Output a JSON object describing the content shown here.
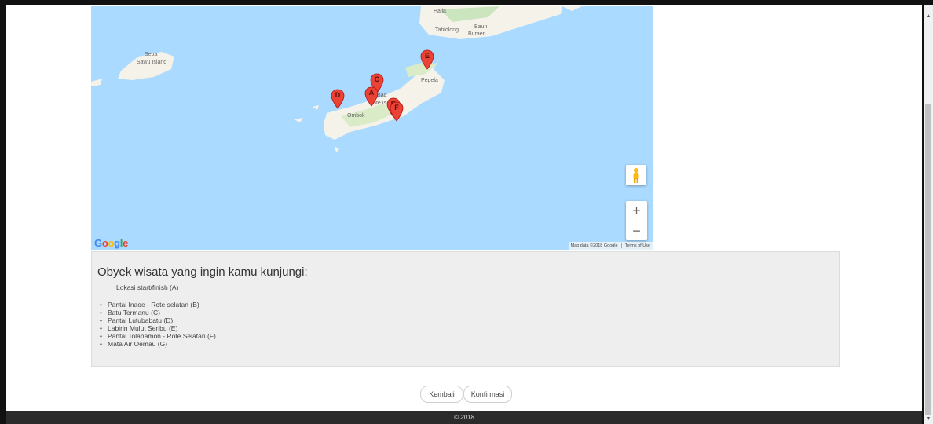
{
  "map": {
    "labels": {
      "halla": "Halla",
      "tablolong": "Tablolong",
      "baun": "Baun",
      "buraen": "Buraen",
      "seba": "Seba",
      "sawu_island": "Sawu Island",
      "pepela": "Pepela",
      "baa": "Baa",
      "rote_island": "Rote Is",
      "ombok": "Ombok"
    },
    "markers": [
      "A",
      "B",
      "C",
      "D",
      "E",
      "F"
    ],
    "logo": "Google",
    "attribution": "Map data ©2018 Google",
    "terms": "Terms of Use",
    "zoom_in": "+",
    "zoom_out": "−",
    "marker_color": "#ea4335",
    "water_color": "#aadaff",
    "land_color": "#f5f2e9"
  },
  "panel": {
    "title": "Obyek wisata yang ingin kamu kunjungi:",
    "start": "Lokasi start/finish (A)",
    "destinations": [
      "Pantai Inaoe - Rote selatan (B)",
      "Batu Termanu (C)",
      "Pantai Lutubabatu (D)",
      "Labirin Mulut Seribu (E)",
      "Pantai Tolanamon - Rote Selatan (F)",
      "Mata Air Oemau (G)"
    ]
  },
  "buttons": {
    "back": "Kembali",
    "confirm": "Konfirmasi"
  },
  "footer": {
    "copyright": "© 2018"
  }
}
